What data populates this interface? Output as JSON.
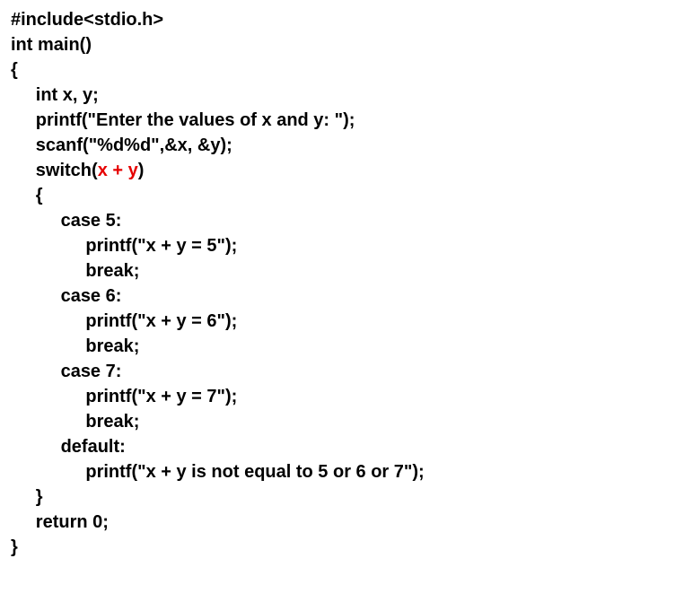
{
  "code": {
    "lines": [
      "#include<stdio.h>",
      "int main()",
      "{",
      "     int x, y;",
      "     printf(\"Enter the values of x and y: \");",
      "     scanf(\"%d%d\",&x, &y);",
      "     switch(",
      ")",
      "     {",
      "          case 5:",
      "               printf(\"x + y = 5\");",
      "               break;",
      "          case 6:",
      "               printf(\"x + y = 6\");",
      "               break;",
      "          case 7:",
      "               printf(\"x + y = 7\");",
      "               break;",
      "          default:",
      "               printf(\"x + y is not equal to 5 or 6 or 7\");",
      "     }",
      "     return 0;",
      "}"
    ],
    "highlight_text": "x + y"
  }
}
